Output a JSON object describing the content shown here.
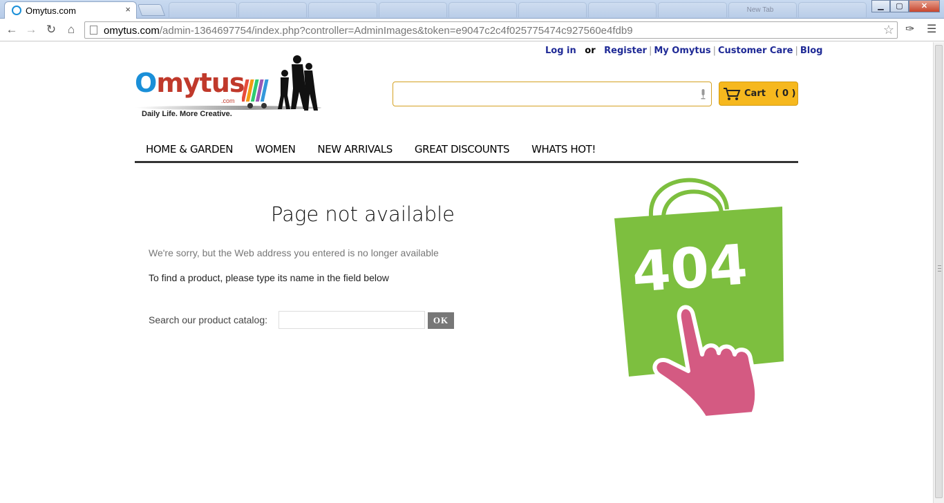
{
  "browser": {
    "tab_title": "Omytus.com",
    "tab_close": "×",
    "background_tabs": [
      "",
      "",
      "",
      "",
      "",
      "",
      "",
      "",
      "New Tab",
      ""
    ],
    "url_host": "omytus.com",
    "url_path": "/admin-1364697754/index.php?controller=AdminImages&token=e9047c2c4f025775474c927560e4fdb9",
    "window_buttons": {
      "minimize": "▁",
      "maximize": "▢",
      "close": "✕"
    }
  },
  "top_links": {
    "login": "Log in",
    "or": "or",
    "register": "Register",
    "my_account": "My Omytus",
    "customer_care": "Customer Care",
    "blog": "Blog"
  },
  "logo": {
    "name_o": "O",
    "name_rest": "mytus",
    "dotcom": ".com",
    "tagline": "Daily Life. More Creative."
  },
  "search": {
    "placeholder": ""
  },
  "cart": {
    "label": "Cart   ( 0 )"
  },
  "menu": {
    "items": [
      "HOME & GARDEN",
      "WOMEN",
      "NEW ARRIVALS",
      "GREAT DISCOUNTS",
      "WHATS HOT!"
    ]
  },
  "error": {
    "title": "Page not available",
    "message": "We're sorry, but the Web address you entered is no longer available",
    "hint": "To find a product, please type its name in the field below",
    "search_label": "Search our product catalog:",
    "ok_button": "OK",
    "badge_code": "404"
  },
  "colors": {
    "link_blue": "#1f2a96",
    "cart_yellow": "#f6b81e",
    "bag_green": "#7dbf3f",
    "hand_pink": "#d45a82"
  }
}
